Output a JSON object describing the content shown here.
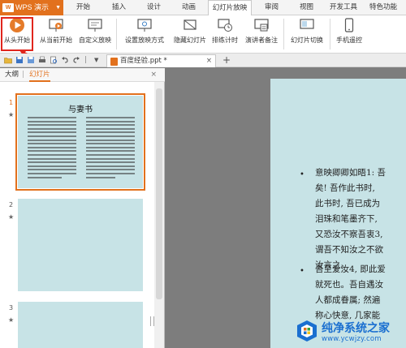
{
  "app": {
    "name": "WPS 演示",
    "logo_text": "W"
  },
  "menu": [
    "开始",
    "插入",
    "设计",
    "动画",
    "幻灯片放映",
    "审阅",
    "视图",
    "开发工具",
    "特色功能"
  ],
  "menu_active": "幻灯片放映",
  "ribbon": {
    "from_start": "从头开始",
    "from_current": "从当前开始",
    "custom_show": "自定义放映",
    "setup_show": "设置放映方式",
    "hide_slide": "隐藏幻灯片",
    "rehearse": "排练计时",
    "presenter_notes": "演讲者备注",
    "slide_switch": "幻灯片切换",
    "phone_remote": "手机遥控"
  },
  "document_tab": {
    "name": "百度经验.ppt *",
    "close": "×",
    "new_tab": "+"
  },
  "panel": {
    "tabs": [
      "大纲",
      "幻灯片"
    ],
    "active_tab": "幻灯片",
    "close": "×"
  },
  "thumbnails": [
    {
      "number": "1",
      "title": "与妻书",
      "selected": true
    },
    {
      "number": "2",
      "title": "",
      "selected": false
    },
    {
      "number": "3",
      "title": "",
      "selected": false
    }
  ],
  "slide": {
    "bullet_symbol": "•",
    "lines": [
      "意映卿卿如晤1: 吾",
      "矣! 吾作此书时,",
      "此书时, 吾已成为",
      "泪珠和笔墨齐下,",
      "又恐汝不察吾衷3,",
      "谓吾不知汝之不欲",
      "汝言之。",
      "吾至爱汝4, 即此爱",
      "就死也。吾自遇汝",
      "人都成眷属; 然遍",
      "称心快意, 几家能"
    ]
  },
  "watermark": {
    "title": "纯净系统之家",
    "url": "www.ycwjzy.com"
  },
  "colors": {
    "accent": "#e2711d",
    "highlight": "#e0261d",
    "slide_bg": "#c7e3e6",
    "workspace": "#7d7d7d"
  }
}
